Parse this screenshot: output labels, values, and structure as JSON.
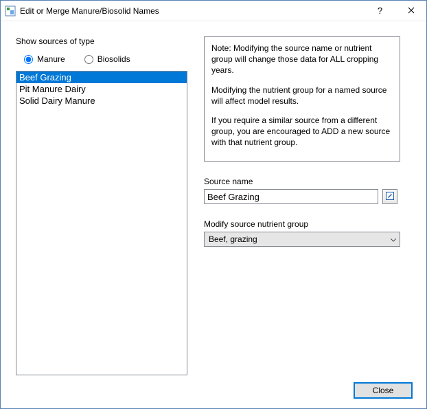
{
  "window": {
    "title": "Edit or Merge Manure/Biosolid Names"
  },
  "left": {
    "group_label": "Show sources of type",
    "radios": {
      "manure": "Manure",
      "biosolids": "Biosolids",
      "selected": "manure"
    },
    "list": {
      "items": [
        "Beef Grazing",
        "Pit Manure Dairy",
        "Solid Dairy Manure"
      ],
      "selected_index": 0
    }
  },
  "right": {
    "note": {
      "p1": "Note: Modifying the source name or nutrient group will change those data for ALL cropping years.",
      "p2": "Modifying the nutrient group for a named source will affect model results.",
      "p3": "If you require a similar source from a different group, you are encouraged to ADD a new source with that nutrient group."
    },
    "source_name_label": "Source name",
    "source_name_value": "Beef Grazing",
    "modify_group_label": "Modify source nutrient group",
    "modify_group_value": "Beef, grazing"
  },
  "footer": {
    "close_label": "Close"
  }
}
